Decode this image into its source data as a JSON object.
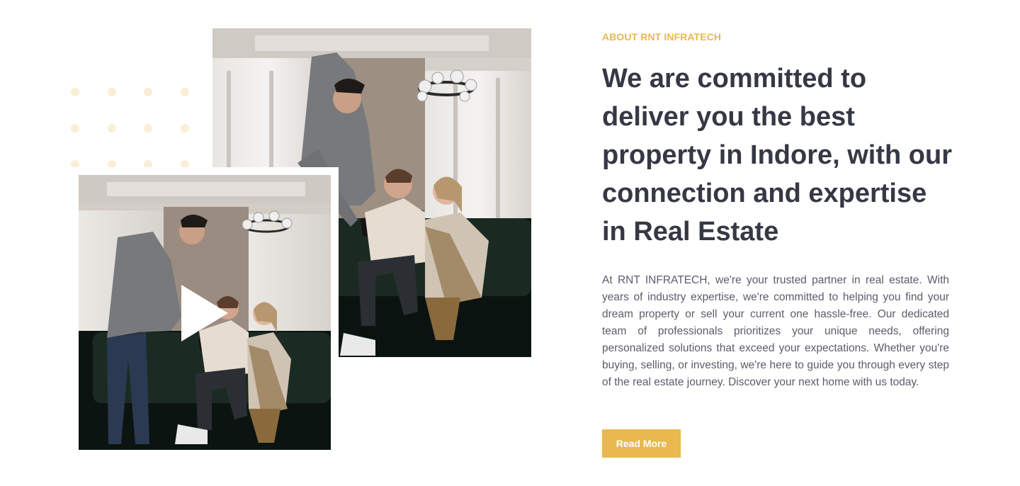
{
  "about": {
    "eyebrow": "ABOUT RNT INFRATECH",
    "headline": "We are committed to deliver you the best property in Indore, with our connection and expertise in Real Estate",
    "description": "At RNT INFRATECH, we're your trusted partner in real estate. With years of industry expertise, we're committed to helping you find your dream property or sell your current one hassle-free. Our dedicated team of professionals prioritizes your unique needs, offering personalized solutions that exceed your expectations. Whether you're buying, selling, or investing, we're here to guide you through every step of the real estate journey. Discover your next home with us today.",
    "read_more_label": "Read More"
  },
  "media": {
    "play_icon": "play-icon"
  },
  "colors": {
    "accent": "#e9b84f",
    "heading": "#363845",
    "body": "#5b5d6b",
    "dot": "#fbeed6"
  }
}
